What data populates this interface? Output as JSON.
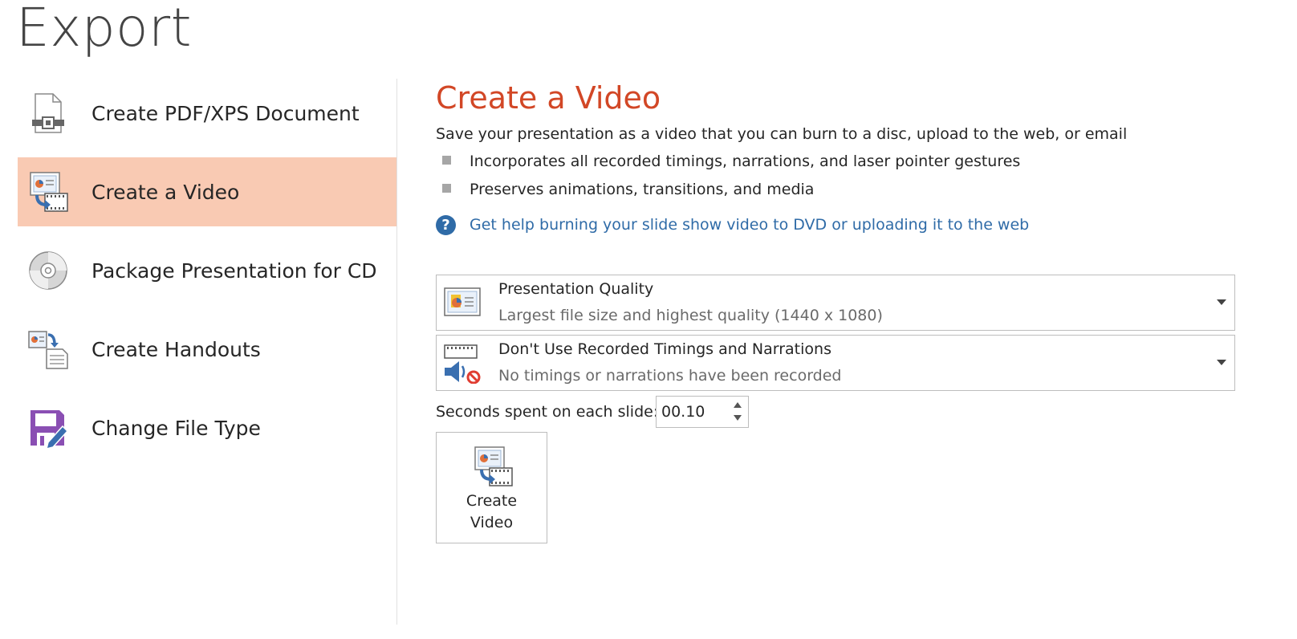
{
  "page": {
    "title": "Export"
  },
  "nav": {
    "items": [
      {
        "label": "Create PDF/XPS Document",
        "icon": "pdf-document-icon",
        "selected": false
      },
      {
        "label": "Create a Video",
        "icon": "create-video-icon",
        "selected": true
      },
      {
        "label": "Package Presentation for CD",
        "icon": "cd-disc-icon",
        "selected": false
      },
      {
        "label": "Create Handouts",
        "icon": "handouts-icon",
        "selected": false
      },
      {
        "label": "Change File Type",
        "icon": "save-as-icon",
        "selected": false
      }
    ]
  },
  "main": {
    "title": "Create a Video",
    "description": "Save your presentation as a video that you can burn to a disc, upload to the web, or email",
    "bullets": [
      "Incorporates all recorded timings, narrations, and laser pointer gestures",
      "Preserves animations, transitions, and media"
    ],
    "help_link": "Get help burning your slide show video to DVD or uploading it to the web",
    "quality_dropdown": {
      "title": "Presentation Quality",
      "subtitle": "Largest file size and highest quality (1440 x 1080)",
      "icon": "presentation-quality-icon"
    },
    "timings_dropdown": {
      "title": "Don't Use Recorded Timings and Narrations",
      "subtitle": "No timings or narrations have been recorded",
      "icon": "no-narration-icon"
    },
    "seconds_label": "Seconds spent on each slide:",
    "seconds_value": "00.10",
    "create_button": {
      "line1": "Create",
      "line2": "Video"
    }
  },
  "colors": {
    "accent": "#d24726",
    "selected_bg": "#f9cab3",
    "link": "#2f6ba7"
  }
}
